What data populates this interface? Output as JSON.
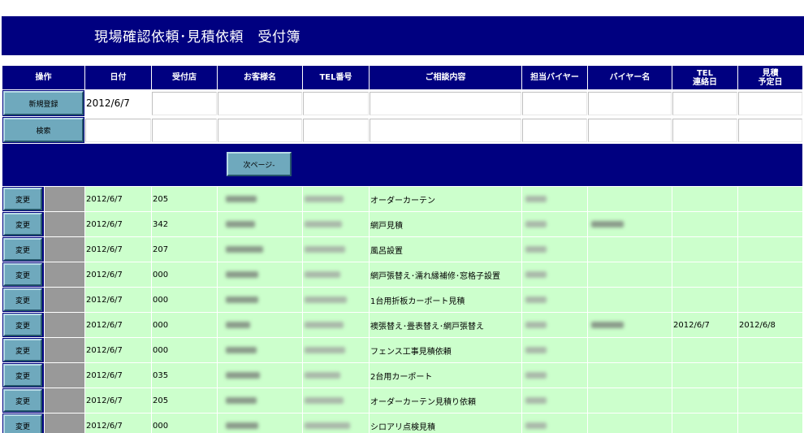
{
  "title": "現場確認依頼･見積依頼　受付簿",
  "headers": {
    "op": "操作",
    "date": "日付",
    "store": "受付店",
    "customer": "お客様名",
    "tel": "TEL番号",
    "consult": "ご相談内容",
    "buyer_in_charge": "担当バイヤー",
    "buyer_name": "バイヤー名",
    "tel_contact_day": "TEL\n連絡日",
    "estimate_day": "見積\n予定日"
  },
  "new_entry": {
    "button": "新規登録",
    "date": "2012/6/7"
  },
  "search": {
    "button": "検索"
  },
  "next_page": "次ページ-",
  "edit_label": "変更",
  "rows": [
    {
      "date": "2012/6/7",
      "store": "205",
      "consult": "オーダーカーテン",
      "tel_day": "",
      "est_day": ""
    },
    {
      "date": "2012/6/7",
      "store": "342",
      "consult": "網戸見積",
      "tel_day": "",
      "est_day": ""
    },
    {
      "date": "2012/6/7",
      "store": "207",
      "consult": "風呂設置",
      "tel_day": "",
      "est_day": ""
    },
    {
      "date": "2012/6/7",
      "store": "000",
      "consult": "網戸張替え･濡れ縁補修･窓格子設置",
      "tel_day": "",
      "est_day": ""
    },
    {
      "date": "2012/6/7",
      "store": "000",
      "consult": "1台用折板カーポート見積",
      "tel_day": "",
      "est_day": ""
    },
    {
      "date": "2012/6/7",
      "store": "000",
      "consult": "襖張替え･畳表替え･網戸張替え",
      "tel_day": "2012/6/7",
      "est_day": "2012/6/8"
    },
    {
      "date": "2012/6/7",
      "store": "000",
      "consult": "フェンス工事見積依頼",
      "tel_day": "",
      "est_day": ""
    },
    {
      "date": "2012/6/7",
      "store": "035",
      "consult": "2台用カーポート",
      "tel_day": "",
      "est_day": ""
    },
    {
      "date": "2012/6/7",
      "store": "205",
      "consult": "オーダーカーテン見積り依頼",
      "tel_day": "",
      "est_day": ""
    },
    {
      "date": "2012/6/7",
      "store": "000",
      "consult": "シロアリ点検見積",
      "tel_day": "",
      "est_day": ""
    }
  ]
}
